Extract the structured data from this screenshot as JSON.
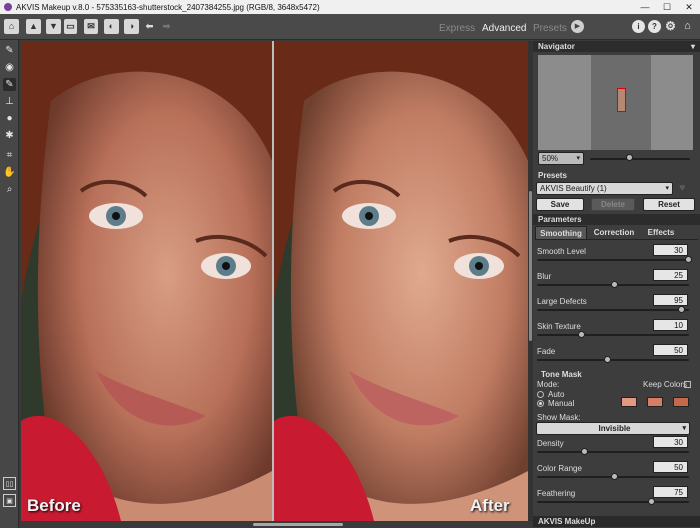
{
  "window": {
    "title": "AKVIS Makeup v.8.0 - 575335163-shutterstock_2407384255.jpg (RGB/8, 3648x5472)"
  },
  "toolbar": {
    "modes": [
      "Express",
      "Advanced",
      "Presets"
    ],
    "active_mode": "Advanced",
    "buttons": [
      "open-image",
      "save-image",
      "batch",
      "print",
      "share",
      "before-after",
      "run",
      "undo",
      "redo"
    ]
  },
  "left_tools": [
    "brush",
    "eye",
    "brush-active",
    "stamp",
    "drop",
    "erase-history",
    "crop",
    "hand",
    "zoom"
  ],
  "canvas": {
    "before_label": "Before",
    "after_label": "After"
  },
  "navigator": {
    "title": "Navigator",
    "zoom": "50%"
  },
  "presets": {
    "title": "Presets",
    "selected": "AKVIS Beautify (1)",
    "save": "Save",
    "delete": "Delete",
    "reset": "Reset"
  },
  "parameters": {
    "title": "Parameters",
    "tabs": [
      "Smoothing",
      "Correction",
      "Effects"
    ],
    "active_tab": "Smoothing",
    "sliders": [
      {
        "label": "Smooth Level",
        "value": "30",
        "fraction": 1.0
      },
      {
        "label": "Blur",
        "value": "25",
        "fraction": 0.5
      },
      {
        "label": "Large Defects",
        "value": "95",
        "fraction": 0.95
      },
      {
        "label": "Skin Texture",
        "value": "10",
        "fraction": 0.28
      },
      {
        "label": "Fade",
        "value": "50",
        "fraction": 0.45
      }
    ],
    "tone_mask": {
      "title": "Tone Mask",
      "mode_label": "Mode:",
      "keep_colors": "Keep Colors",
      "auto": "Auto",
      "manual": "Manual",
      "selected_mode": "Manual",
      "colors": [
        "#e2997f",
        "#d67e62",
        "#c5694c"
      ],
      "show_mask_label": "Show Mask:",
      "show_mask_value": "Invisible"
    },
    "sliders2": [
      {
        "label": "Density",
        "value": "30",
        "fraction": 0.3
      },
      {
        "label": "Color Range",
        "value": "50",
        "fraction": 0.5
      },
      {
        "label": "Feathering",
        "value": "75",
        "fraction": 0.75
      }
    ]
  },
  "bottom_panel": {
    "title": "AKVIS MakeUp"
  }
}
